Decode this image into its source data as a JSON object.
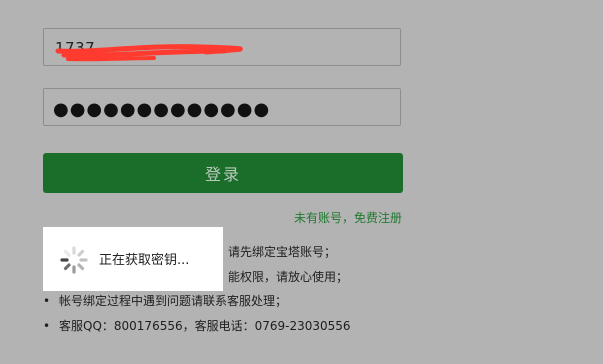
{
  "login_form": {
    "username_value": "1737",
    "password_mask": "●●●●●●●●●●●●●",
    "login_label": "登录",
    "register_link": "未有账号，免费注册"
  },
  "tips": [
    "请先绑定宝塔账号；",
    "能权限，请放心使用；",
    "帐号绑定过程中遇到问题请联系客服处理；",
    "客服QQ：800176556，客服电话：0769-23030556"
  ],
  "loading": {
    "text": "正在获取密钥..."
  },
  "colors": {
    "backdrop": "#b3b3b3",
    "button": "#1b6e2a",
    "link": "#1f7a2f",
    "redaction": "#ff3b30"
  }
}
